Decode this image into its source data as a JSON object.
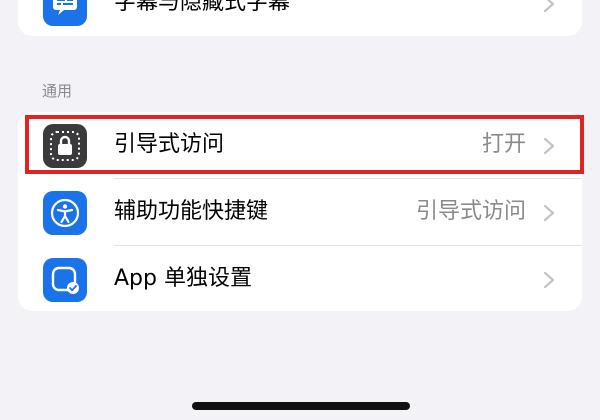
{
  "top_row": {
    "label": "字幕与隐藏式字幕"
  },
  "section_header": "通用",
  "rows": [
    {
      "label": "引导式访问",
      "value": "打开",
      "icon": "lock-icon"
    },
    {
      "label": "辅助功能快捷键",
      "value": "引导式访问",
      "icon": "accessibility-icon"
    },
    {
      "label": "App 单独设置",
      "value": "",
      "icon": "app-settings-icon"
    }
  ],
  "colors": {
    "highlight": "#e02424",
    "blue_tile": "#1a73e8",
    "dark_tile": "#3a3a3c"
  }
}
